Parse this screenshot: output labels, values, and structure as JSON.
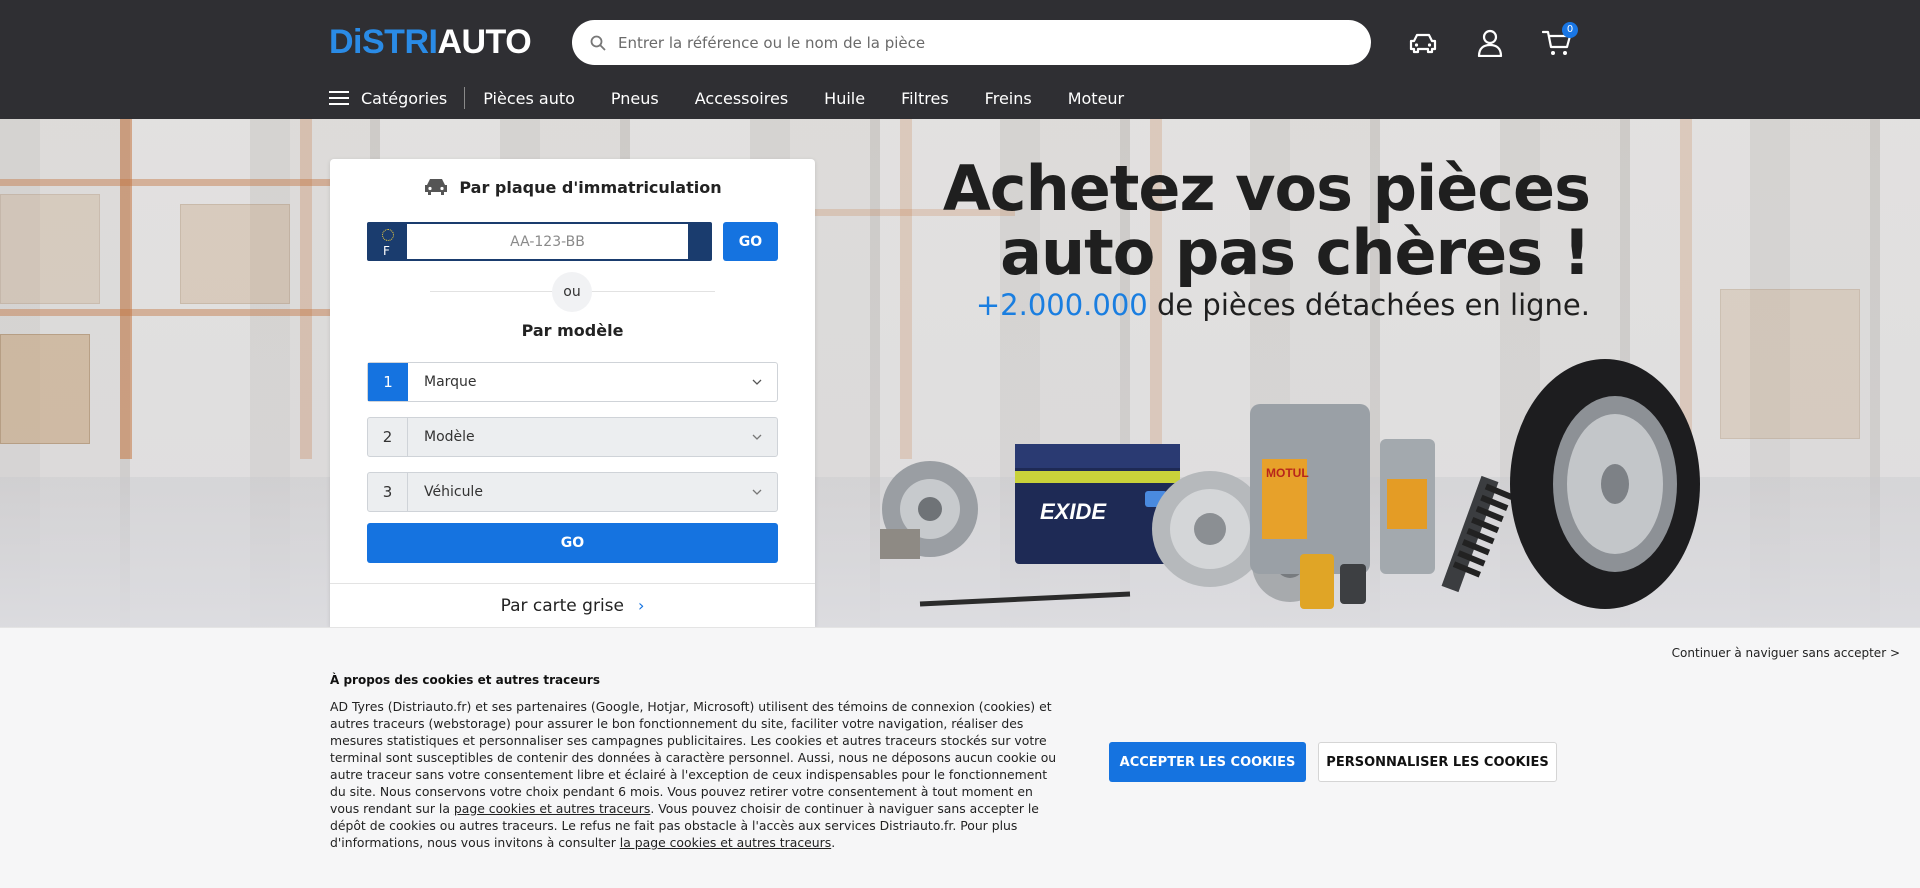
{
  "header": {
    "logo": {
      "part1": "DiSTRI",
      "part2": "AUTO"
    },
    "search": {
      "placeholder": "Entrer la référence ou le nom de la pièce"
    },
    "cart_count": "0",
    "icons": [
      "car-icon",
      "user-icon",
      "cart-icon"
    ]
  },
  "nav": {
    "categories_label": "Catégories",
    "items": [
      "Pièces auto",
      "Pneus",
      "Accessoires",
      "Huile",
      "Filtres",
      "Freins",
      "Moteur"
    ]
  },
  "search_panel": {
    "plate_title": "Par plaque d'immatriculation",
    "plate_country": "F",
    "plate_placeholder": "AA-123-BB",
    "plate_go": "GO",
    "or_label": "ou",
    "model_title": "Par modèle",
    "selects": [
      {
        "num": "1",
        "label": "Marque"
      },
      {
        "num": "2",
        "label": "Modèle"
      },
      {
        "num": "3",
        "label": "Véhicule"
      }
    ],
    "model_go": "GO",
    "carte_grise": "Par carte grise"
  },
  "hero": {
    "title_line1": "Achetez vos pièces",
    "title_line2": "auto pas chères !",
    "subtitle_highlight": "+2.000.000",
    "subtitle_rest": " de pièces détachées en ligne.",
    "battery_brand": "EXIDE",
    "oil_brand": "MOTUL"
  },
  "cookie": {
    "continue": "Continuer à naviguer sans accepter >",
    "title": "À propos des cookies et autres traceurs",
    "text_part1": "AD Tyres (Distriauto.fr) et ses partenaires (Google, Hotjar, Microsoft) utilisent des témoins de connexion (cookies) et autres traceurs (webstorage) pour assurer le bon fonctionnement du site, faciliter votre navigation, réaliser des mesures statistiques et personnaliser ses campagnes publicitaires. Les cookies et autres traceurs stockés sur votre terminal sont susceptibles de contenir des données à caractère personnel. Aussi, nous ne déposons aucun cookie ou autre traceur sans votre consentement libre et éclairé à l'exception de ceux indispensables pour le fonctionnement du site. Nous conservons votre choix pendant 6 mois. Vous pouvez retirer votre consentement à tout moment en vous rendant sur la ",
    "link1": "page cookies et autres traceurs",
    "text_part2": ". Vous pouvez choisir de continuer à naviguer sans accepter le dépôt de cookies ou autres traceurs. Le refus ne fait pas obstacle à l'accès aux services Distriauto.fr. Pour plus d'informations, nous vous invitons à consulter ",
    "link2": "la page cookies et autres traceurs",
    "text_part3": ".",
    "accept": "ACCEPTER LES COOKIES",
    "customize": "PERSONNALISER LES COOKIES"
  },
  "colors": {
    "header_bg": "#2f2f33",
    "accent": "#1573e0",
    "logo_blue": "#2a8be6",
    "plate_blue": "#1a3c6e"
  }
}
